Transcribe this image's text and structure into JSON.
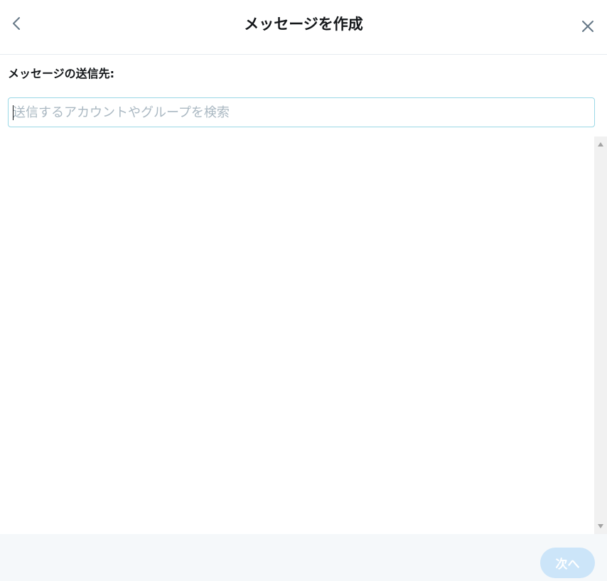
{
  "header": {
    "title": "メッセージを作成",
    "back_icon": "chevron-left-icon",
    "close_icon": "close-icon"
  },
  "recipient": {
    "label": "メッセージの送信先:",
    "placeholder": "送信するアカウントやグループを検索",
    "value": ""
  },
  "footer": {
    "next_label": "次へ",
    "next_enabled": false
  },
  "colors": {
    "accent_border": "#9ad8e6",
    "disabled_button": "#cce5f9",
    "footer_bg": "#f5f8fa",
    "icon": "#657786"
  }
}
